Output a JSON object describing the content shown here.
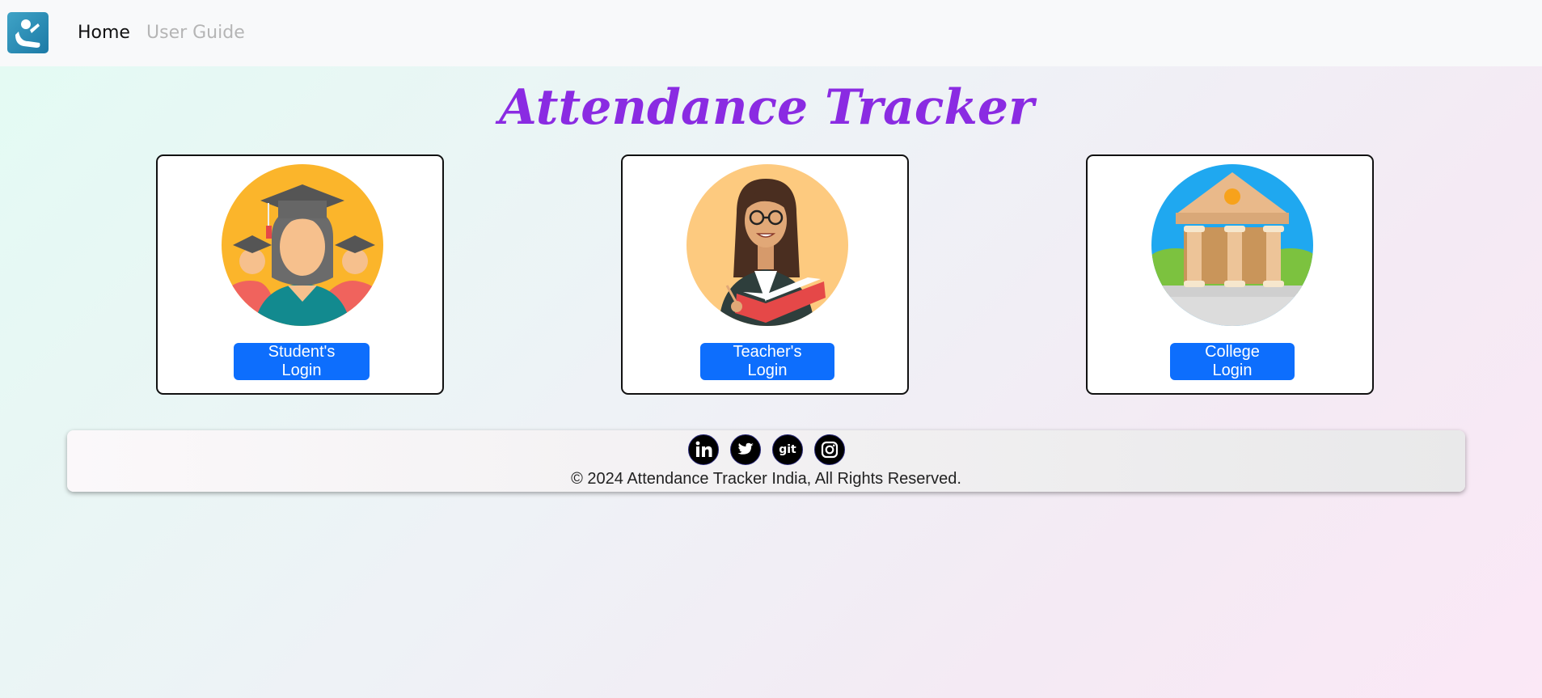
{
  "navbar": {
    "logo_icon": "attendance-logo-icon",
    "links": [
      {
        "label": "Home",
        "active": true
      },
      {
        "label": "User Guide",
        "active": false
      }
    ]
  },
  "main": {
    "title": "Attendance Tracker",
    "title_color": "#8a2be2",
    "cards": [
      {
        "image": "graduates-illustration",
        "button_label": "Student's Login"
      },
      {
        "image": "teacher-illustration",
        "button_label": "Teacher's Login"
      },
      {
        "image": "college-building-illustration",
        "button_label": "College Login"
      }
    ],
    "button_color": "#0d6efd"
  },
  "footer": {
    "social_icons": [
      "linkedin-icon",
      "twitter-icon",
      "github-icon",
      "instagram-icon"
    ],
    "git_label": "git",
    "copyright": "© 2024 Attendance Tracker India, All Rights Reserved."
  }
}
